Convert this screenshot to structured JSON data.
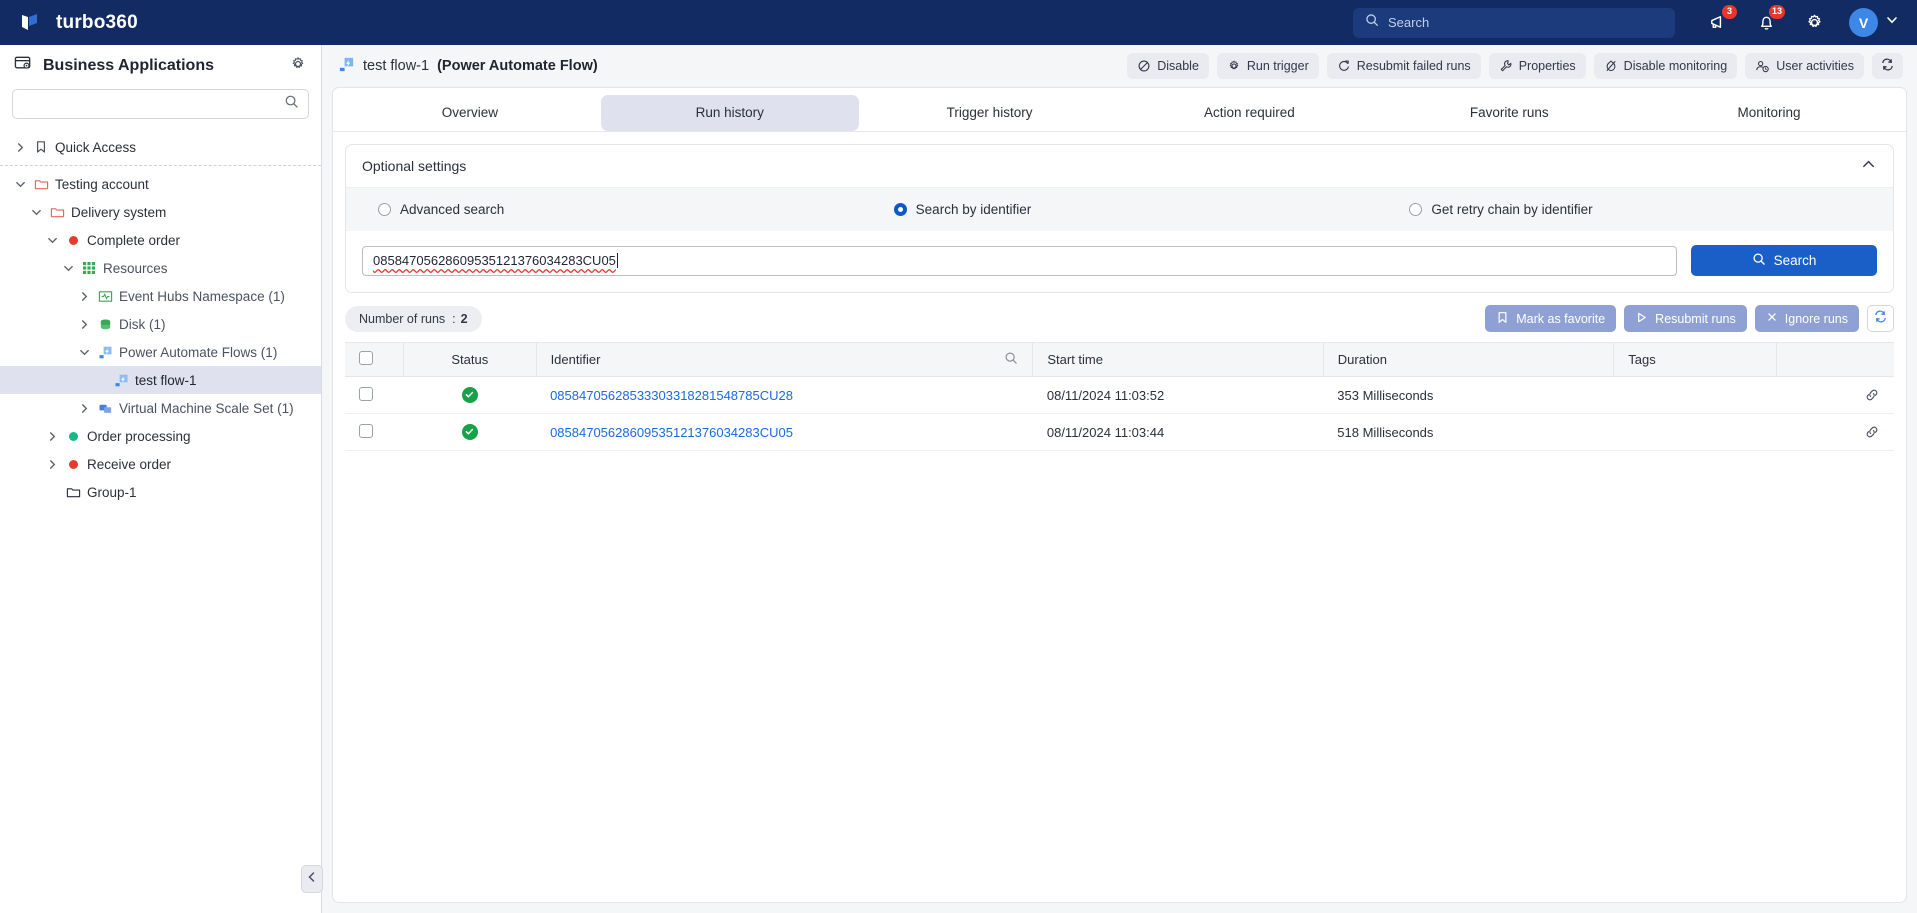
{
  "topbar": {
    "brand": "turbo360",
    "search_placeholder": "Search",
    "announcements_badge": "3",
    "notifications_badge": "13",
    "avatar_initial": "V"
  },
  "sidebar": {
    "title": "Business Applications",
    "search_value": "",
    "tree": [
      {
        "label": "Quick Access",
        "icon": "bookmark-icon",
        "chevron": "right",
        "indent": 0,
        "selected": false,
        "dot": ""
      },
      {
        "label": "Testing account",
        "icon": "folder-icon",
        "chevron": "down",
        "indent": 0,
        "selected": false,
        "dot": ""
      },
      {
        "label": "Delivery system",
        "icon": "folder-icon",
        "chevron": "down",
        "indent": 1,
        "selected": false,
        "dot": ""
      },
      {
        "label": "Complete order",
        "icon": "status-dot",
        "chevron": "down",
        "indent": 2,
        "selected": false,
        "dot": "#e8392c"
      },
      {
        "label": "Resources",
        "icon": "grid-icon",
        "chevron": "down",
        "indent": 3,
        "selected": false,
        "dot": ""
      },
      {
        "label": "Event Hubs Namespace (1)",
        "icon": "event-hubs-icon",
        "chevron": "right",
        "indent": 4,
        "selected": false,
        "dot": ""
      },
      {
        "label": "Disk (1)",
        "icon": "disk-icon",
        "chevron": "right",
        "indent": 4,
        "selected": false,
        "dot": ""
      },
      {
        "label": "Power Automate Flows (1)",
        "icon": "power-automate-icon",
        "chevron": "down",
        "indent": 4,
        "selected": false,
        "dot": ""
      },
      {
        "label": "test flow-1",
        "icon": "power-automate-icon",
        "chevron": "none",
        "indent": 5,
        "selected": true,
        "dot": ""
      },
      {
        "label": "Virtual Machine Scale Set (1)",
        "icon": "vmss-icon",
        "chevron": "right",
        "indent": 4,
        "selected": false,
        "dot": ""
      },
      {
        "label": "Order processing",
        "icon": "status-dot",
        "chevron": "right",
        "indent": 2,
        "selected": false,
        "dot": "#16b981"
      },
      {
        "label": "Receive order",
        "icon": "status-dot",
        "chevron": "right",
        "indent": 2,
        "selected": false,
        "dot": "#e8392c"
      },
      {
        "label": "Group-1",
        "icon": "folder-dark-icon",
        "chevron": "none",
        "indent": 2,
        "selected": false,
        "dot": ""
      }
    ]
  },
  "main": {
    "flow_name": "test flow-1",
    "flow_type": "(Power Automate Flow)",
    "actions": [
      {
        "label": "Disable",
        "icon": "disable-icon"
      },
      {
        "label": "Run trigger",
        "icon": "gear-icon"
      },
      {
        "label": "Resubmit failed runs",
        "icon": "resubmit-icon"
      },
      {
        "label": "Properties",
        "icon": "wrench-icon"
      },
      {
        "label": "Disable monitoring",
        "icon": "monitoring-off-icon"
      },
      {
        "label": "User activities",
        "icon": "user-clock-icon"
      }
    ],
    "tabs": [
      {
        "label": "Overview",
        "active": false
      },
      {
        "label": "Run history",
        "active": true
      },
      {
        "label": "Trigger history",
        "active": false
      },
      {
        "label": "Action required",
        "active": false
      },
      {
        "label": "Favorite runs",
        "active": false
      },
      {
        "label": "Monitoring",
        "active": false
      }
    ],
    "optional_settings": {
      "title": "Optional settings",
      "radios": [
        {
          "label": "Advanced search",
          "selected": false
        },
        {
          "label": "Search by identifier",
          "selected": true
        },
        {
          "label": "Get retry chain by identifier",
          "selected": false
        }
      ],
      "identifier_value": "08584705628609535121376034283CU05",
      "search_button": "Search"
    },
    "toolbar": {
      "runs_label": "Number of runs",
      "runs_separator": ":",
      "runs_count": "2",
      "mark_favorite": "Mark as favorite",
      "resubmit_runs": "Resubmit runs",
      "ignore_runs": "Ignore runs"
    },
    "table": {
      "columns": [
        "Status",
        "Identifier",
        "Start time",
        "Duration",
        "Tags"
      ],
      "rows": [
        {
          "status": "Succeeded",
          "identifier": "08584705628533303318281548785CU28",
          "start_time": "08/11/2024 11:03:52",
          "duration": "353 Milliseconds",
          "tags": ""
        },
        {
          "status": "Succeeded",
          "identifier": "08584705628609535121376034283CU05",
          "start_time": "08/11/2024 11:03:44",
          "duration": "518 Milliseconds",
          "tags": ""
        }
      ]
    }
  },
  "colors": {
    "brand_navy": "#122b63",
    "accent_blue": "#1a5fc8",
    "link_blue": "#1a6ae0",
    "success_green": "#17a24a",
    "badge_red": "#e8362c"
  }
}
